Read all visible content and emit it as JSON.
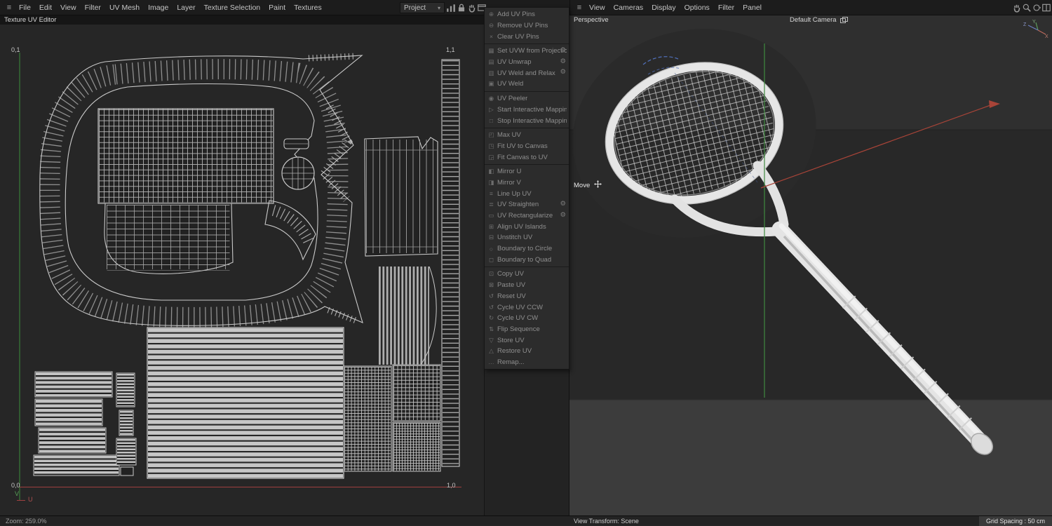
{
  "menubar": {
    "hamburger": "≡",
    "items": [
      "File",
      "Edit",
      "View",
      "Filter",
      "UV Mesh",
      "Image",
      "Layer",
      "Texture Selection",
      "Paint",
      "Textures"
    ]
  },
  "toolbar": {
    "project": "Project",
    "caret": "▾"
  },
  "header": {
    "title": "Texture UV Editor"
  },
  "canvas": {
    "corner_tl": "0,1",
    "corner_tr": "1,1",
    "corner_bl": "0,0",
    "corner_br": "1,0",
    "axis_u": "U",
    "axis_v": "V",
    "accent_u": "#a04040",
    "accent_v": "#3c8f3c"
  },
  "uv_menu": {
    "gear_icon": "⚙",
    "items": [
      {
        "label": "Add UV Pins",
        "icon": "⊕",
        "gear": false,
        "sep": false
      },
      {
        "label": "Remove UV Pins",
        "icon": "⊖",
        "gear": false,
        "sep": false
      },
      {
        "label": "Clear UV Pins",
        "icon": "×",
        "gear": false,
        "sep": false
      },
      {
        "label": "Set UVW from Projection",
        "icon": "▦",
        "gear": true,
        "sep": true
      },
      {
        "label": "UV Unwrap",
        "icon": "▤",
        "gear": true,
        "sep": false
      },
      {
        "label": "UV Weld and Relax",
        "icon": "▥",
        "gear": true,
        "sep": false
      },
      {
        "label": "UV Weld",
        "icon": "▣",
        "gear": false,
        "sep": false
      },
      {
        "label": "UV Peeler",
        "icon": "◉",
        "gear": false,
        "sep": true
      },
      {
        "label": "Start Interactive Mapping",
        "icon": "▷",
        "gear": false,
        "sep": false
      },
      {
        "label": "Stop Interactive Mapping",
        "icon": "□",
        "gear": false,
        "sep": false
      },
      {
        "label": "Max UV",
        "icon": "◰",
        "gear": false,
        "sep": true
      },
      {
        "label": "Fit UV to Canvas",
        "icon": "◳",
        "gear": false,
        "sep": false
      },
      {
        "label": "Fit Canvas to UV",
        "icon": "◲",
        "gear": false,
        "sep": false
      },
      {
        "label": "Mirror U",
        "icon": "◧",
        "gear": false,
        "sep": true
      },
      {
        "label": "Mirror V",
        "icon": "◨",
        "gear": false,
        "sep": false
      },
      {
        "label": "Line Up UV",
        "icon": "≡",
        "gear": false,
        "sep": false
      },
      {
        "label": "UV Straighten",
        "icon": "≣",
        "gear": true,
        "sep": false
      },
      {
        "label": "UV Rectangularize",
        "icon": "▭",
        "gear": true,
        "sep": false
      },
      {
        "label": "Align UV Islands",
        "icon": "⊞",
        "gear": false,
        "sep": false
      },
      {
        "label": "Unstitch UV",
        "icon": "⊟",
        "gear": false,
        "sep": false
      },
      {
        "label": "Boundary to Circle",
        "icon": "○",
        "gear": false,
        "sep": false
      },
      {
        "label": "Boundary to Quad",
        "icon": "◻",
        "gear": false,
        "sep": false
      },
      {
        "label": "Copy UV",
        "icon": "⊡",
        "gear": false,
        "sep": true
      },
      {
        "label": "Paste UV",
        "icon": "⊠",
        "gear": false,
        "sep": false
      },
      {
        "label": "Reset UV",
        "icon": "↺",
        "gear": false,
        "sep": false
      },
      {
        "label": "Cycle UV CCW",
        "icon": "↺",
        "gear": false,
        "sep": false
      },
      {
        "label": "Cycle UV CW",
        "icon": "↻",
        "gear": false,
        "sep": false
      },
      {
        "label": "Flip Sequence",
        "icon": "⇅",
        "gear": false,
        "sep": false
      },
      {
        "label": "Store UV",
        "icon": "▽",
        "gear": false,
        "sep": false
      },
      {
        "label": "Restore UV",
        "icon": "△",
        "gear": false,
        "sep": false
      },
      {
        "label": "Remap...",
        "icon": "…",
        "gear": false,
        "sep": false
      }
    ]
  },
  "vp": {
    "hamburger": "≡",
    "menus": [
      "View",
      "Cameras",
      "Display",
      "Options",
      "Filter",
      "Panel"
    ],
    "perspective": "Perspective",
    "camera": "Default Camera",
    "tool": "Move",
    "giz_x": "X",
    "giz_y": "Y",
    "giz_z": "Z"
  },
  "statusbar": {
    "zoom": "Zoom: 259.0%",
    "view_transform": "View Transform: Scene",
    "grid_spacing": "Grid Spacing : 50 cm"
  }
}
